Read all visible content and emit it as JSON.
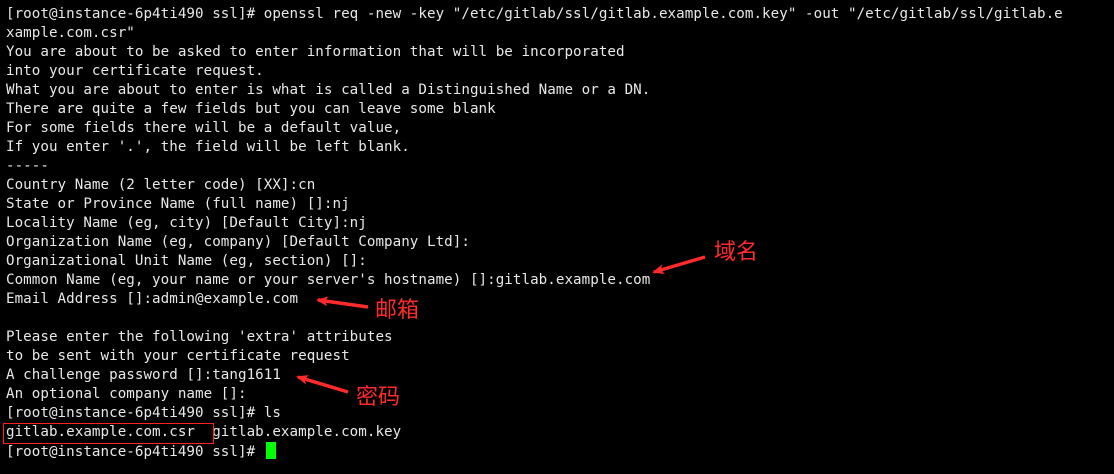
{
  "terminal": {
    "lines": [
      "[root@instance-6p4ti490 ssl]# openssl req -new -key \"/etc/gitlab/ssl/gitlab.example.com.key\" -out \"/etc/gitlab/ssl/gitlab.e",
      "xample.com.csr\"",
      "You are about to be asked to enter information that will be incorporated",
      "into your certificate request.",
      "What you are about to enter is what is called a Distinguished Name or a DN.",
      "There are quite a few fields but you can leave some blank",
      "For some fields there will be a default value,",
      "If you enter '.', the field will be left blank.",
      "-----",
      "Country Name (2 letter code) [XX]:cn",
      "State or Province Name (full name) []:nj",
      "Locality Name (eg, city) [Default City]:nj",
      "Organization Name (eg, company) [Default Company Ltd]:",
      "Organizational Unit Name (eg, section) []:",
      "Common Name (eg, your name or your server's hostname) []:gitlab.example.com",
      "Email Address []:admin@example.com",
      "",
      "Please enter the following 'extra' attributes",
      "to be sent with your certificate request",
      "A challenge password []:tang1611",
      "An optional company name []:",
      "[root@instance-6p4ti490 ssl]# ls",
      "gitlab.example.com.csr  gitlab.example.com.key",
      "[root@instance-6p4ti490 ssl]# "
    ]
  },
  "annotations": {
    "domain_label": "域名",
    "email_label": "邮箱",
    "password_label": "密码",
    "color": "#ff2a2a"
  },
  "cursor_color": "#00ff00"
}
